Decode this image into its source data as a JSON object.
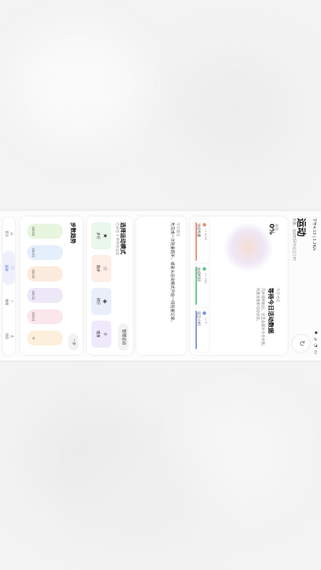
{
  "status": {
    "time": "下午4:13 | 1.2K/s",
    "icons": "✱ ⊿ ◔ ▭"
  },
  "header": {
    "title": "运动",
    "subtitle": "热量、运动时间与站立小时"
  },
  "hero": {
    "goal_label": "目标",
    "goal_percent": "0%",
    "label": "今日活动",
    "headline": "等待今日活动数据",
    "desc": "同步或刷新后，这里会展示今日步数、热量进度和活动状态。",
    "metrics": [
      {
        "value": "•• kcal",
        "label": "活动热量",
        "color": "#f08a7a"
      },
      {
        "value": "•• min",
        "label": "运动时间",
        "color": "#63c58c"
      },
      {
        "value": "•• h",
        "label": "站立小时",
        "color": "#7b94e0"
      }
    ]
  },
  "suggestion": {
    "label": "今日建议",
    "text": "先完成一次轻量跑步，或者从运动模式开始一段轻量记录。"
  },
  "modes": {
    "title": "选择运动模式",
    "subtitle": "已添加 4 种常用运动",
    "manage_label": "管理运动",
    "items": [
      {
        "icon": "★",
        "label": "步行",
        "color": "#e9f7ec"
      },
      {
        "icon": "☆",
        "label": "跑步",
        "color": "#fdeee6"
      },
      {
        "icon": "◈",
        "label": "骑行",
        "color": "#e9eefb"
      },
      {
        "icon": "✧",
        "label": "健身",
        "color": "#efeafb"
      }
    ]
  },
  "steps": {
    "title": "步数趋势",
    "more_label": "一步",
    "days": [
      {
        "date": "08/28",
        "color": "#e8f5df"
      },
      {
        "date": "08/29",
        "color": "#e5eefb"
      },
      {
        "date": "08/30",
        "color": "#fcebdc"
      },
      {
        "date": "08/31",
        "color": "#ece8f8"
      },
      {
        "date": "09/01",
        "color": "#fbe6ec"
      },
      {
        "date": "今",
        "color": "#fcf0dc"
      }
    ]
  },
  "nav": {
    "items": [
      {
        "icon": "⌂",
        "label": "首页"
      },
      {
        "icon": "♡",
        "label": "运动"
      },
      {
        "icon": "☾",
        "label": "睡眠"
      },
      {
        "icon": "♙",
        "label": "我的"
      }
    ]
  }
}
